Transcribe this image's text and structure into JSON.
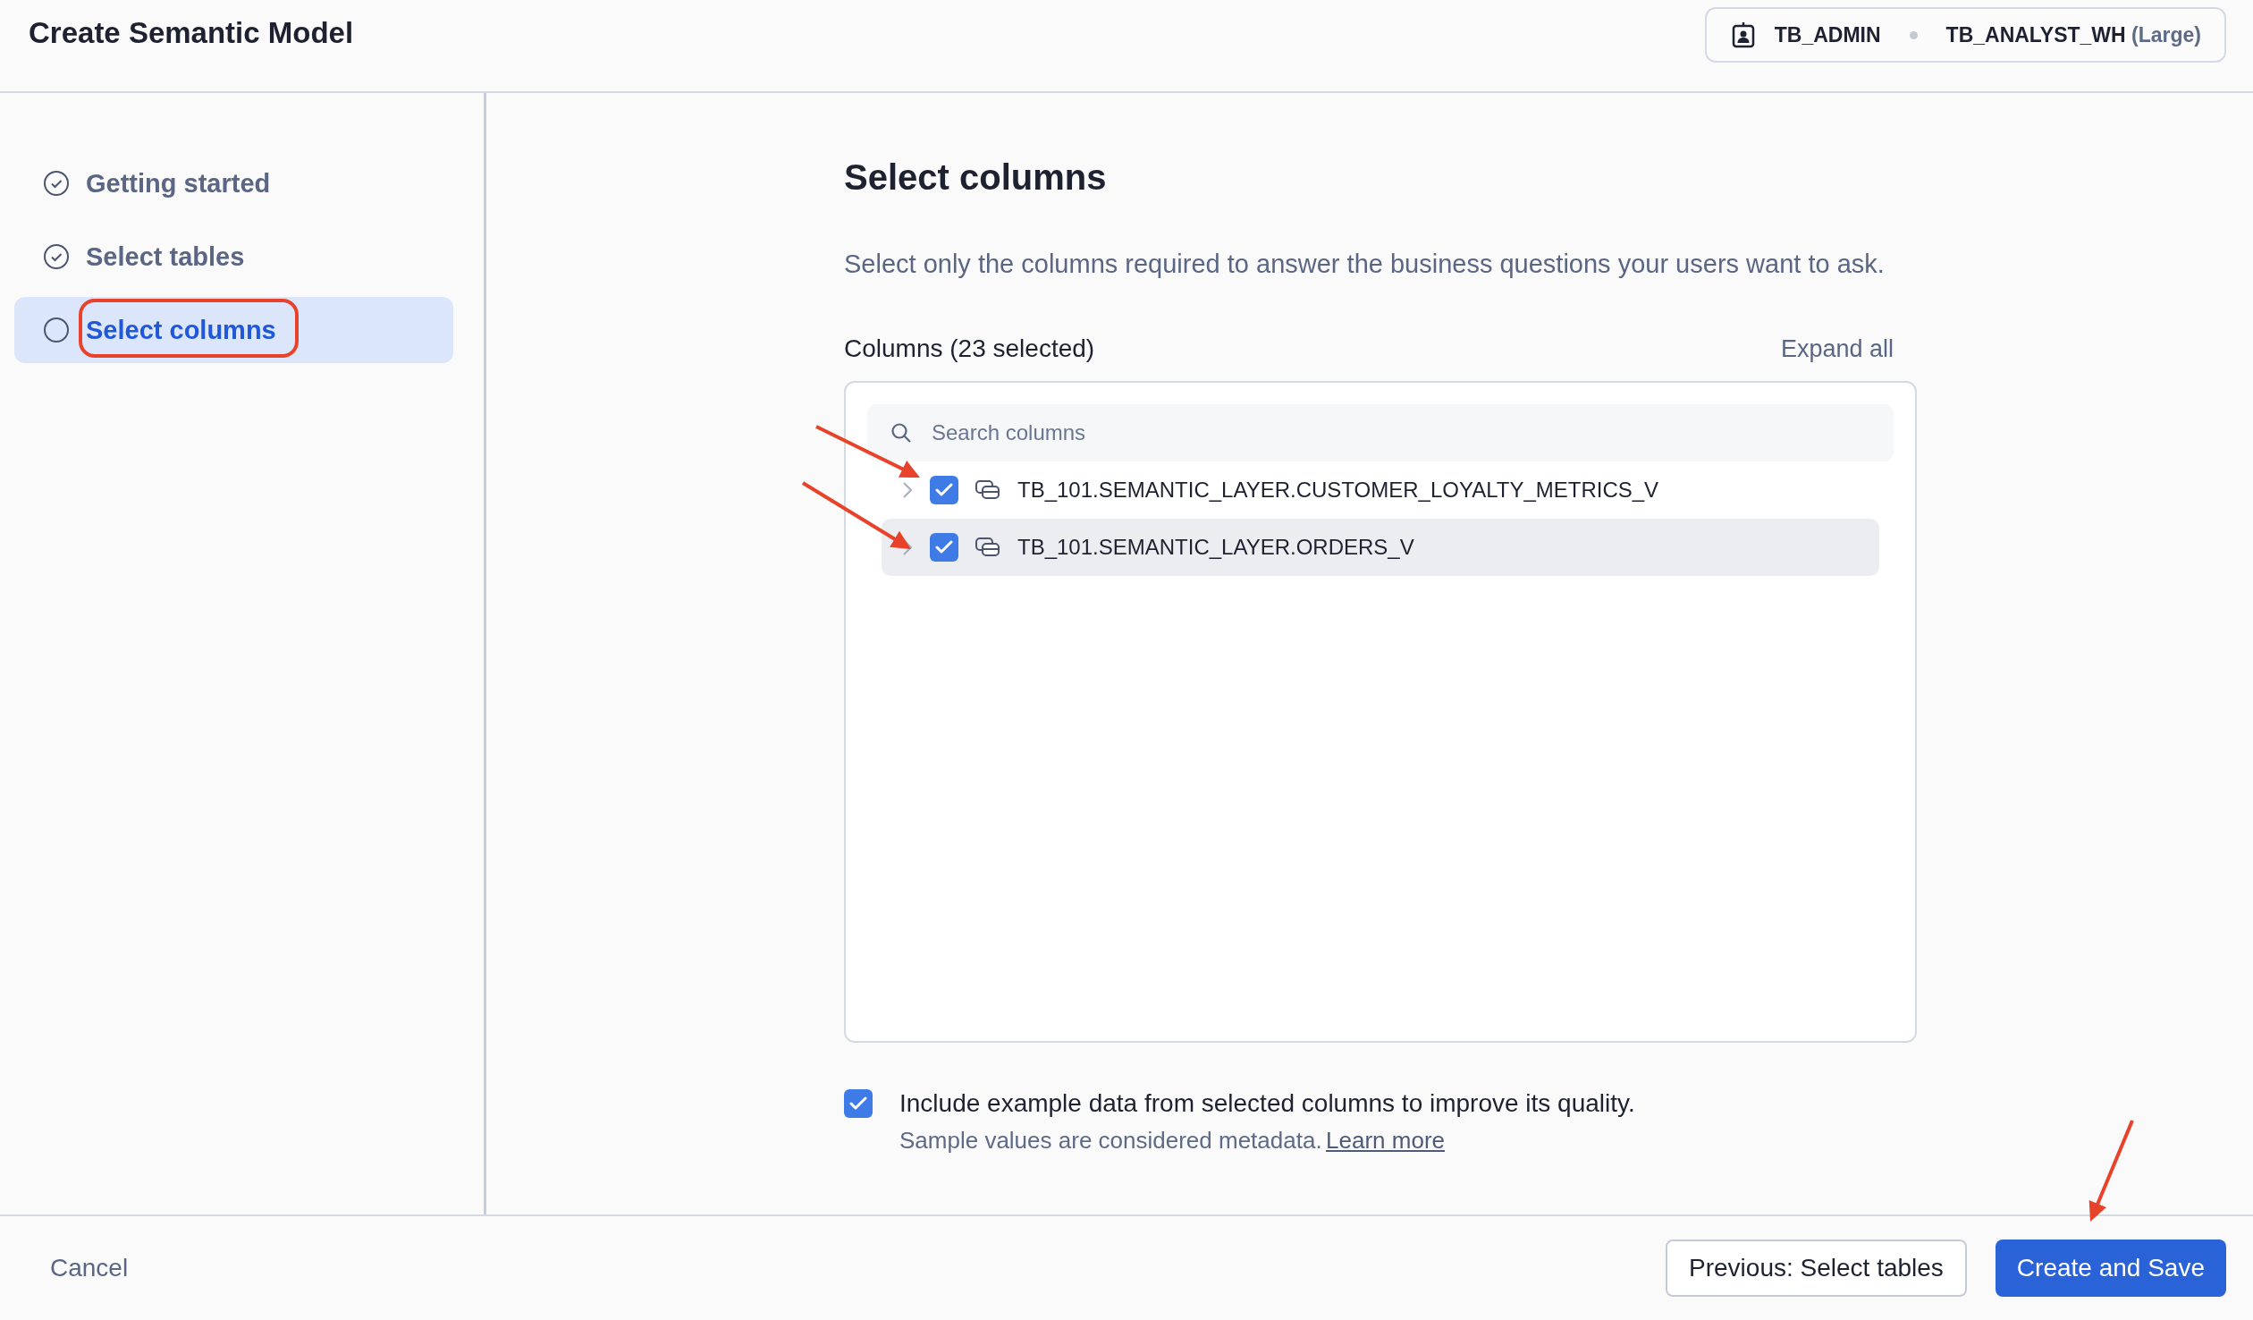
{
  "header": {
    "title": "Create Semantic Model",
    "role": "TB_ADMIN",
    "warehouse": "TB_ANALYST_WH",
    "warehouse_size": "(Large)"
  },
  "steps": [
    {
      "label": "Getting started",
      "completed": true,
      "selected": false
    },
    {
      "label": "Select tables",
      "completed": true,
      "selected": false
    },
    {
      "label": "Select columns",
      "completed": false,
      "selected": true
    }
  ],
  "content": {
    "title": "Select columns",
    "description": "Select only the columns required to answer the business questions your users want to ask.",
    "columns_label": "Columns (23 selected)",
    "expand_all": "Expand all",
    "search": {
      "placeholder": "Search columns"
    },
    "tables": [
      {
        "name": "TB_101.SEMANTIC_LAYER.CUSTOMER_LOYALTY_METRICS_V",
        "checked": true,
        "expanded": false,
        "selected": false
      },
      {
        "name": "TB_101.SEMANTIC_LAYER.ORDERS_V",
        "checked": true,
        "expanded": false,
        "selected": true
      }
    ],
    "include_example": {
      "checked": true,
      "label": "Include example data from selected columns to improve its quality.",
      "note": "Sample values are considered metadata.",
      "link": "Learn more"
    }
  },
  "footer": {
    "cancel": "Cancel",
    "previous": "Previous: Select tables",
    "create": "Create and Save"
  }
}
